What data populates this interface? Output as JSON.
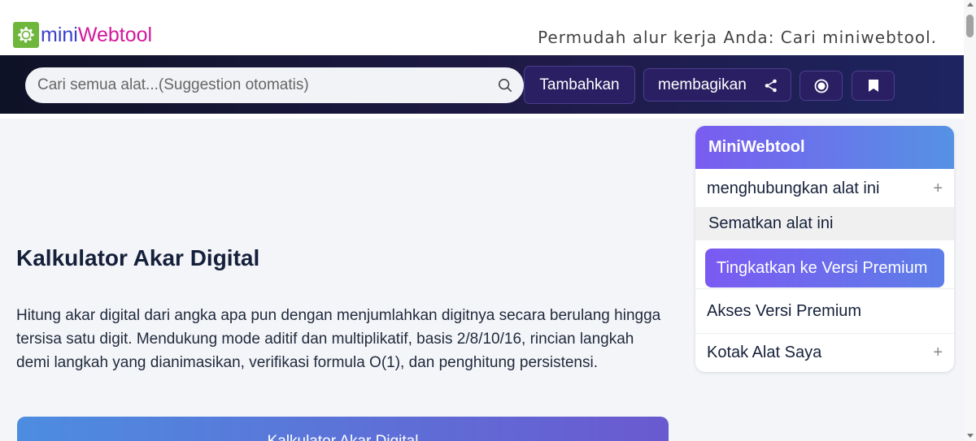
{
  "header": {
    "logo_mini": "mini",
    "logo_web": "Webtool",
    "tagline": "Permudah alur kerja Anda: Cari miniwebtool."
  },
  "nav": {
    "search_placeholder": "Cari semua alat...(Suggestion otomatis)",
    "add_label": "Tambahkan",
    "share_label": "membagikan"
  },
  "main": {
    "title": "Kalkulator Akar Digital",
    "description": "Hitung akar digital dari angka apa pun dengan menjumlahkan digitnya secara berulang hingga tersisa satu digit. Mendukung mode aditif dan multiplikatif, basis 2/8/10/16, rincian langkah demi langkah yang dianimasikan, verifikasi formula O(1), dan penghitung persistensi.",
    "calculator_title": "Kalkulator Akar Digital"
  },
  "sidebar": {
    "title": "MiniWebtool",
    "link_tool": "menghubungkan alat ini",
    "embed_tool": "Sematkan alat ini",
    "upgrade": "Tingkatkan ke Versi Premium",
    "access_premium": "Akses Versi Premium",
    "my_toolbox": "Kotak Alat Saya",
    "plus": "+"
  },
  "colors": {
    "logo_green": "#6fb73c",
    "logo_mini": "#3b3fce",
    "logo_web": "#d4189b",
    "nav_dark": "#0e1226",
    "button_purple": "#2b1f63",
    "premium_start": "#7b5af2",
    "premium_end": "#5d7ee8"
  },
  "icons": {
    "logo": "gear-icon",
    "search": "search-icon",
    "share": "share-icon",
    "radio": "radio-button-icon",
    "bookmark": "bookmark-icon"
  }
}
